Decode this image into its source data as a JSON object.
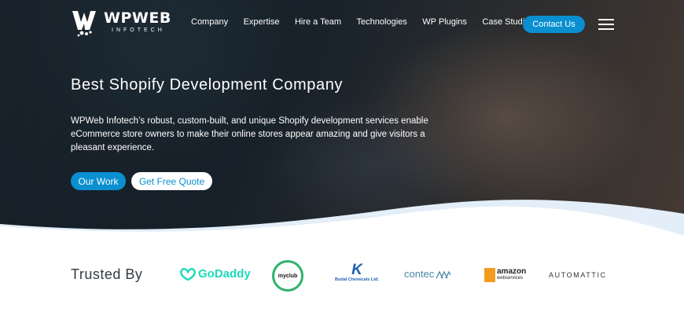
{
  "header": {
    "logo_name": "WPWEB",
    "logo_sub": "INFOTECH",
    "nav": [
      "Company",
      "Expertise",
      "Hire a Team",
      "Technologies",
      "WP Plugins",
      "Case Studies"
    ],
    "contact_label": "Contact Us"
  },
  "hero": {
    "title": "Best Shopify Development Company",
    "description": "WPWeb Infotech’s robust, custom-built, and unique Shopify development services enable eCommerce store owners to make their online stores appear amazing and give visitors a pleasant experience.",
    "primary_button": "Our Work",
    "secondary_button": "Get Free Quote"
  },
  "trusted": {
    "title": "Trusted By",
    "brands": {
      "godaddy": "GoDaddy",
      "myclub": "myclub",
      "budal": "Budal Chemicals Ltd.",
      "contec": "contec",
      "amazon": "amazon",
      "amazon_sub": "webservices",
      "automattic": "AUTOMATTIC"
    }
  },
  "colors": {
    "accent": "#0a8fd1",
    "godaddy": "#1bdbb9",
    "myclub": "#2db36a"
  },
  "icons": [
    "wpweb-logo-icon",
    "hamburger-menu-icon",
    "godaddy-logo-icon"
  ]
}
